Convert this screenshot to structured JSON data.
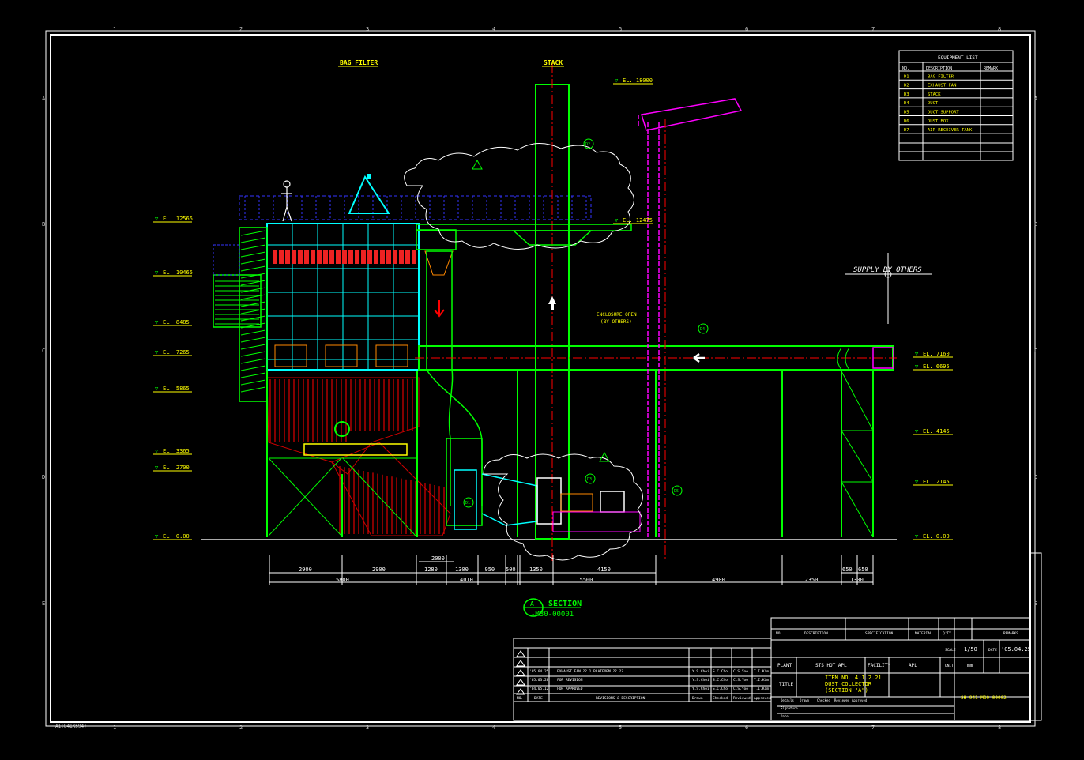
{
  "border": {
    "columns": [
      "1",
      "2",
      "3",
      "4",
      "5",
      "6",
      "7",
      "8"
    ],
    "rows": [
      "A",
      "B",
      "C",
      "D",
      "E"
    ],
    "sheet_size": "A1(841X594)"
  },
  "labels": {
    "bag_filter": "BAG FILTER",
    "stack": "STACK",
    "supply_by_others": "SUPPLY  BY OTHERS",
    "enclosure_line1": "ENCLOSURE OPEN",
    "enclosure_line2": "(BY OTHERS)",
    "section_letter": "A",
    "section_title": "SECTION",
    "section_ref": "-M30-00001"
  },
  "elevations_left": [
    "EL. 12565",
    "EL. 10465",
    "EL. 8485",
    "EL. 7265",
    "EL. 5865",
    "EL. 3365",
    "EL. 2700",
    "EL. 0.00"
  ],
  "elevations_right": [
    "EL. 7160",
    "EL. 6695",
    "EL. 4145",
    "EL. 2145",
    "EL. 0.00"
  ],
  "elevations_mid": [
    "EL. 18000",
    "EL. 12475"
  ],
  "dimensions": {
    "row1": [
      "2900",
      "2900",
      "1280",
      "1300",
      "950",
      "500",
      "1350",
      "4150",
      "650",
      "650"
    ],
    "row0": [
      "2000"
    ],
    "row2": [
      "5800",
      "4010",
      "5500",
      "4900",
      "2350",
      "1300"
    ]
  },
  "callouts": [
    "D1",
    "D2",
    "D3",
    "D4",
    "D5",
    "D6",
    "D7"
  ],
  "equipment_list": {
    "title": "EQUIPMENT LIST",
    "headers": [
      "NO.",
      "DESCRIPTION",
      "REMARK"
    ],
    "rows": [
      [
        "D1",
        "BAG FILTER",
        ""
      ],
      [
        "D2",
        "EXHAUST FAN",
        ""
      ],
      [
        "D3",
        "STACK",
        ""
      ],
      [
        "D4",
        "DUCT",
        ""
      ],
      [
        "D5",
        "DUCT SUPPORT",
        ""
      ],
      [
        "D6",
        "DUST BOX",
        ""
      ],
      [
        "D7",
        "AIR RECEIVER TANK",
        ""
      ]
    ]
  },
  "title_block": {
    "bom_headers": [
      "NO.",
      "DESCRIPTION",
      "SPECIFICATION",
      "MATERIAL",
      "Q'TY",
      "REMARKS"
    ],
    "plant_label": "PLANT",
    "plant_value": "STS HOT APL",
    "facility_label": "FACILITY",
    "facility_value": "APL",
    "title_label": "TITLE",
    "title_lines": [
      "ITEM NO. 4.1.2.21",
      "DUST COLLECTOR",
      "(SECTION \"A\")"
    ],
    "scale_label": "SCALE",
    "scale_value": "1/50",
    "date_label": "DATE",
    "date_value": "'05.04.25",
    "unit_label": "UNIT",
    "unit_value": "mm",
    "drawing_no": "SH-941-M30-00002",
    "sign_rows": [
      "Details",
      "Signature",
      "Date"
    ],
    "sign_cols": [
      "Drawn",
      "Checked",
      "Reviewed",
      "Approved"
    ]
  },
  "revisions": {
    "rows": [
      [
        "'05.04.25",
        "EXHAUST FAN ?? 1 PLATFORM ?? ??",
        "Y.S.Choi",
        "S.C.Cho",
        "C.S.Yoo",
        "T.I.Kim"
      ],
      [
        "'05.03.28",
        "FOR REVISION",
        "Y.S.Choi",
        "S.C.Cho",
        "C.S.Yoo",
        "T.I.Kim"
      ],
      [
        "'04.05.12",
        "FOR APPROVED",
        "Y.S.Choi",
        "S.C.Cho",
        "C.S.Yoo",
        "T.I.Kim"
      ]
    ],
    "headers": [
      "NO.",
      "DATE",
      "REVISIONS & DESCRIPTION",
      "Drawn",
      "Checked",
      "Reviewed",
      "Approved"
    ]
  }
}
